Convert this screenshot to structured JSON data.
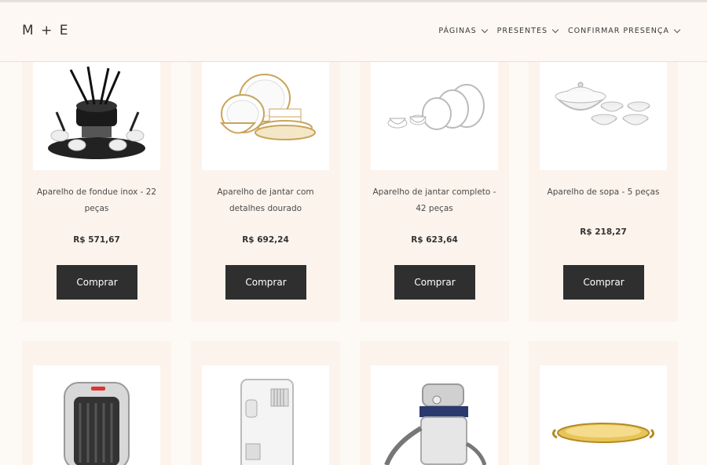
{
  "header": {
    "logo": "M + E",
    "nav": [
      {
        "label": "PÁGINAS"
      },
      {
        "label": "PRESENTES"
      },
      {
        "label": "CONFIRMAR PRESENÇA"
      }
    ]
  },
  "products": [
    {
      "name": "Aparelho de fondue inox - 22 peças",
      "price": "R$ 571,67",
      "button": "Comprar",
      "icon": "fondue-set-icon"
    },
    {
      "name": "Aparelho de jantar com detalhes dourado",
      "price": "R$ 692,24",
      "button": "Comprar",
      "icon": "dinnerware-gold-icon"
    },
    {
      "name": "Aparelho de jantar completo - 42 peças",
      "price": "R$ 623,64",
      "button": "Comprar",
      "icon": "dinnerware-set-icon"
    },
    {
      "name": "Aparelho de sopa - 5 peças",
      "price": "R$ 218,27",
      "button": "Comprar",
      "icon": "soup-set-icon"
    }
  ],
  "products_row2": [
    {
      "icon": "heater-icon"
    },
    {
      "icon": "air-conditioner-icon"
    },
    {
      "icon": "vacuum-cleaner-icon"
    },
    {
      "icon": "gold-tray-icon"
    }
  ]
}
